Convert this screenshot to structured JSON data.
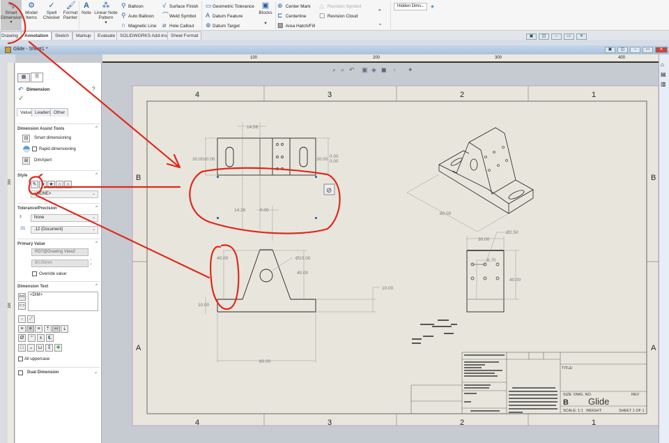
{
  "ribbon": {
    "large_buttons": [
      {
        "label": "Smart Dimension",
        "icon": "smart-dimension-icon"
      },
      {
        "label": "Model Items",
        "icon": "model-items-icon"
      },
      {
        "label": "Spell Checker",
        "icon": "spell-checker-icon"
      },
      {
        "label": "Format Painter",
        "icon": "format-painter-icon"
      },
      {
        "label": "Note",
        "icon": "note-icon"
      },
      {
        "label": "Linear Note Pattern",
        "icon": "linear-note-pattern-icon"
      },
      {
        "label": "Blocks",
        "icon": "blocks-icon"
      }
    ],
    "small_items": [
      "Balloon",
      "Auto Balloon",
      "Magnetic Line",
      "Surface Finish",
      "Weld Symbol",
      "Hole Callout",
      "Geometric Tolerance",
      "Datum Feature",
      "Datum Target",
      "Center Mark",
      "Centerline",
      "Area Hatch/Fill",
      "Revision Symbol",
      "Revision Cloud"
    ],
    "display_dropdown": "Hidden Dims"
  },
  "tabs": [
    "Drawing",
    "Annotation",
    "Sketch",
    "Markup",
    "Evaluate",
    "SOLIDWORKS Add-Ins",
    "Sheet Format"
  ],
  "active_tab": "Annotation",
  "document": {
    "title": "Glide - Sheet1 *"
  },
  "rulers": {
    "horizontal": [
      "100",
      "200",
      "300",
      "400"
    ],
    "vertical": [
      "300",
      "100"
    ]
  },
  "property_manager": {
    "title": "Dimension",
    "tabs": [
      "Value",
      "Leaders",
      "Other"
    ],
    "assist": {
      "header": "Dimension Assist Tools",
      "items": [
        "Smart dimensioning",
        "Rapid dimensioning",
        "DimXpert"
      ]
    },
    "style": {
      "header": "Style",
      "value": "<NONE>"
    },
    "tolerance": {
      "header": "Tolerance/Precision",
      "tolerance": "None",
      "precision": ".12 (Document)"
    },
    "primary": {
      "header": "Primary Value",
      "reference": "RD7@Drawing View2",
      "value": "80.00mm",
      "override": "Override value:"
    },
    "dim_text": {
      "header": "Dimension Text",
      "text": "<DIM>",
      "uppercase": "All uppercase"
    },
    "symbols": [
      "Ø",
      "°",
      "±",
      "℄"
    ],
    "dual": "Dual Dimension"
  },
  "sheet": {
    "zones_top": [
      "4",
      "3",
      "2",
      "1"
    ],
    "zones_side": [
      "B",
      "A"
    ],
    "dimensions": {
      "top_view": [
        "14.56",
        "30.00±0.00",
        "30.00",
        "0.00",
        "0.00",
        "14.26",
        "0.00"
      ],
      "front_view": [
        "40.00",
        "Ø10.00",
        "40.00",
        "10.00",
        "10.00",
        "80.00"
      ],
      "side_view": [
        "30.00",
        "Ø2.50",
        "8.70",
        "40.00"
      ],
      "iso_view": [
        "80.00"
      ]
    },
    "title_block": {
      "title_label": "TITLE:",
      "size_label": "SIZE",
      "dwg_label": "DWG. NO.",
      "rev_label": "REV",
      "size": "B",
      "dwg_no": "Glide",
      "scale": "SCALE: 1:1",
      "weight": "WEIGHT:",
      "sheet": "SHEET 1 OF 1"
    }
  },
  "colors": {
    "annotation_red": "#e0271c",
    "sheet": "#e8e6dc",
    "graphics_bg": "#c6cad1",
    "selection_blue": "#2b5fa6"
  }
}
